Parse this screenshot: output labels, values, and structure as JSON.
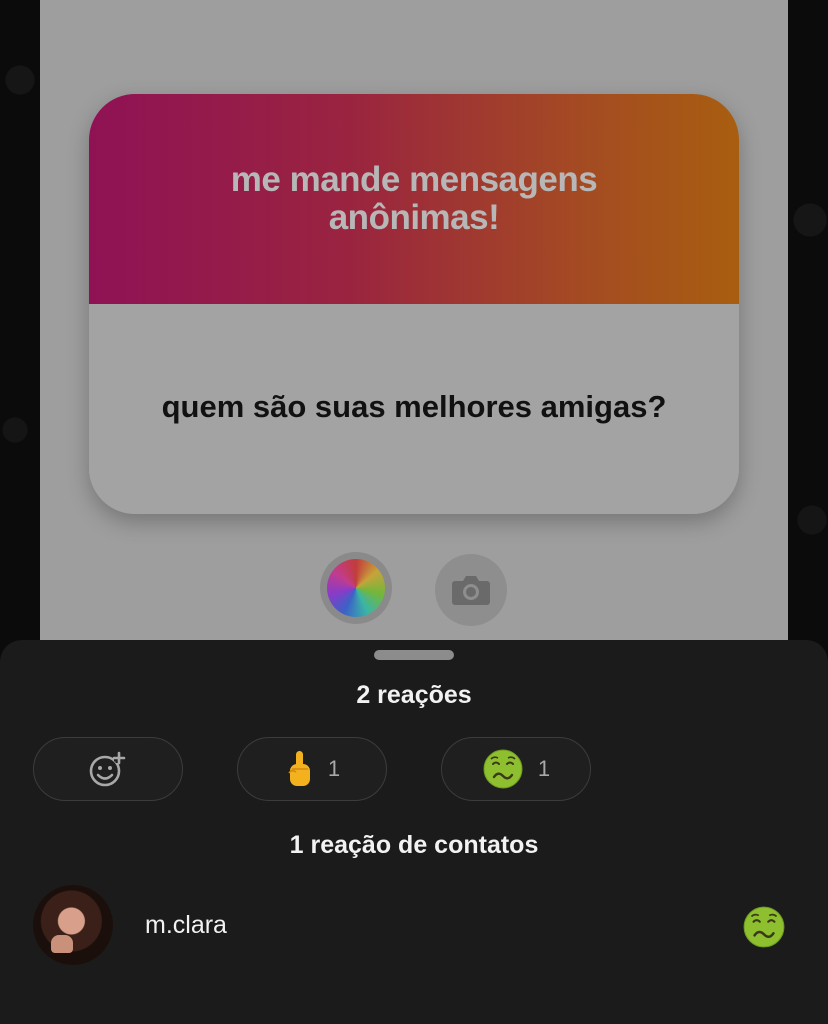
{
  "story": {
    "card_title": "me mande mensagens anônimas!",
    "question": "quem são suas melhores amigas?",
    "color_button_icon": "color-wheel-icon",
    "camera_button_icon": "camera-icon"
  },
  "sheet": {
    "title": "2 reações",
    "reaction_pills": [
      {
        "icon": "add-reaction-icon",
        "count": ""
      },
      {
        "icon": "middle-finger-emoji",
        "count": "1"
      },
      {
        "icon": "nauseated-face-emoji",
        "count": "1"
      }
    ],
    "contacts_title": "1 reação de contatos",
    "contacts": [
      {
        "name": "m.clara",
        "reaction_icon": "nauseated-face-emoji"
      }
    ]
  },
  "colors": {
    "card_gradient_start": "#8f1255",
    "card_gradient_end": "#a85e10",
    "sheet_background": "#1b1b1b",
    "dim_overlay": "#9e9e9e"
  }
}
